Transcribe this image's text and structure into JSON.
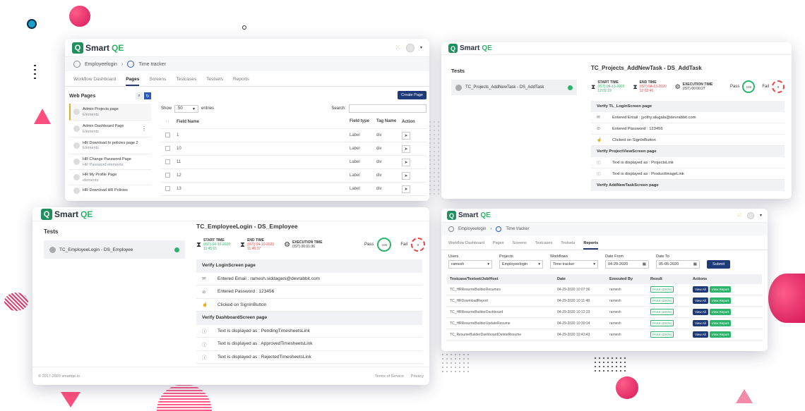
{
  "brand": {
    "logo_smart": "Smart",
    "logo_qe": "QE"
  },
  "colors": {
    "accent": "#1e3a78",
    "green": "#2db36a",
    "pink": "#e8336d",
    "red": "#e84545"
  },
  "win1": {
    "breadcrumb": [
      "Employeelogin",
      "Time tracker"
    ],
    "tabs": [
      "Workflow Dashboard",
      "Pages",
      "Screens",
      "Testcases",
      "Testsets",
      "Reports"
    ],
    "sidebar_title": "Web Pages",
    "pages": [
      {
        "title": "Admin Projects page",
        "sub": "Elements"
      },
      {
        "title": "Admin Dashboard Page",
        "sub": "Elements"
      },
      {
        "title": "HR Download hr policies page 2",
        "sub": "Elements"
      },
      {
        "title": "HR Change Password Page",
        "sub": "HR Password elements"
      },
      {
        "title": "HR My Profile Page",
        "sub": "elements"
      },
      {
        "title": "HR Download HR Policies",
        "sub": ""
      }
    ],
    "create_label": "Create Page",
    "show_label": "Show",
    "show_value": "50",
    "entries_label": "entries",
    "search_label": "Search:",
    "columns": [
      "Field Name",
      "Field type",
      "Tag Name",
      "Action"
    ],
    "rows": [
      {
        "name": "1",
        "type": "Label",
        "tag": "div"
      },
      {
        "name": "10",
        "type": "Label",
        "tag": "div"
      },
      {
        "name": "11",
        "type": "Label",
        "tag": "div"
      },
      {
        "name": "12",
        "type": "Label",
        "tag": "div"
      },
      {
        "name": "13",
        "type": "Label",
        "tag": "div"
      }
    ]
  },
  "win2": {
    "tests_label": "Tests",
    "test_item": "TC_Projects_AddNewTask - DS_AddTask",
    "title": "TC_Projects_AddNewTask - DS_AddTask",
    "start_label": "START TIME",
    "start_value": "(IST) 04-13-2020 12:02:19",
    "end_label": "END TIME",
    "end_value": "(IST) 04-13-2020 12:02:46",
    "exec_label": "EXECUTION TIME",
    "exec_value": "(IST) 00:00:27",
    "pass_label": "Pass",
    "pass_value": "100",
    "fail_label": "Fail",
    "fail_value": "0",
    "steps": [
      {
        "kind": "head",
        "text": "Verify TL_LoginScreen page"
      },
      {
        "kind": "step",
        "icon": "mail-icon",
        "glyph": "✉",
        "text": "Entered Email : jyothy.alugala@devrabbit.com"
      },
      {
        "kind": "step",
        "icon": "eye-off-icon",
        "glyph": "⊘",
        "text": "Entered Password : 123456"
      },
      {
        "kind": "step",
        "icon": "pointer-icon",
        "glyph": "☝",
        "text": "Clicked on SignInButton"
      },
      {
        "kind": "head",
        "text": "Verify ProjectViewScreen page"
      },
      {
        "kind": "step",
        "icon": "info-icon",
        "glyph": "ⓘ",
        "text": "Text is displayed as : ProjectsLink"
      },
      {
        "kind": "step",
        "icon": "info-icon",
        "glyph": "ⓘ",
        "text": "Text is displayed as : ProductImageLink"
      },
      {
        "kind": "head",
        "text": "Verify AddNewTaskScreen page"
      }
    ]
  },
  "win3": {
    "tests_label": "Tests",
    "test_item": "TC_EmployeeLogin - DS_Employee",
    "title": "TC_EmployeeLogin - DS_Employee",
    "start_label": "START TIME",
    "start_value": "(IST) 04-10-2020 11:45:01",
    "end_label": "END TIME",
    "end_value": "(IST) 04-10-2020 11:46:37",
    "exec_label": "EXECUTION TIME",
    "exec_value": "(IST) 00:01:36",
    "pass_label": "Pass",
    "pass_value": "100",
    "fail_label": "Fail",
    "fail_value": "0",
    "steps": [
      {
        "kind": "head",
        "text": "Verify LoginScreen page"
      },
      {
        "kind": "step",
        "icon": "mail-icon",
        "glyph": "✉",
        "text": "Entered Email : ramesh.siddagani@devrabbit.com"
      },
      {
        "kind": "step",
        "icon": "eye-off-icon",
        "glyph": "⊘",
        "text": "Entered Password : 123456"
      },
      {
        "kind": "step",
        "icon": "pointer-icon",
        "glyph": "☝",
        "text": "Clicked on SignInButton"
      },
      {
        "kind": "head",
        "text": "Verify DashboardScreen page"
      },
      {
        "kind": "step",
        "icon": "info-icon",
        "glyph": "ⓘ",
        "text": "Text is displayed as : PendingTimesheetsLink"
      },
      {
        "kind": "step",
        "icon": "info-icon",
        "glyph": "ⓘ",
        "text": "Text is displayed as : ApprovedTimesheetsLink"
      },
      {
        "kind": "step",
        "icon": "info-icon",
        "glyph": "ⓘ",
        "text": "Text is displayed as : RejectedTimesheetsLink"
      }
    ],
    "copyright": "© 2017-2020 smartqe.io",
    "terms": "Terms of Service",
    "privacy": "Privacy"
  },
  "win4": {
    "breadcrumb": [
      "Employeelogin",
      "Time tracker"
    ],
    "tabs": [
      "Workflow Dashboard",
      "Pages",
      "Screens",
      "Testcases",
      "Testsets",
      "Reports"
    ],
    "filters": [
      {
        "label": "Users",
        "value": "ramesh"
      },
      {
        "label": "Projects",
        "value": "Employeelogin"
      },
      {
        "label": "Workflows",
        "value": "Time tracker"
      },
      {
        "label": "Date From",
        "value": "04-29-2020"
      },
      {
        "label": "Date To",
        "value": "05-05-2020"
      }
    ],
    "submit_label": "Submit",
    "columns": [
      "Testcase/Testset/Job/Host",
      "Date",
      "Executed By",
      "Result",
      "Actions"
    ],
    "pass_label": "PASS (100%)",
    "view_all": "View All",
    "view_report": "View Report",
    "rows": [
      {
        "name": "TC_HRResumeBuilderResumes",
        "date": "04-29-2020 10:07:36",
        "by": "ramesh"
      },
      {
        "name": "TC_HRDownloadReport",
        "date": "04-29-2020 10:11:48",
        "by": "ramesh"
      },
      {
        "name": "TC_HRResumeBuilderDashboard",
        "date": "04-29-2020 10:12:23",
        "by": "ramesh"
      },
      {
        "name": "TC_HRResumeBuilderUpdateResume",
        "date": "04-29-2020 10:30:14",
        "by": "ramesh"
      },
      {
        "name": "TC_ResumeBuilderDashboardDeleteResume",
        "date": "04-29-2020 10:43:43",
        "by": "ramesh"
      }
    ]
  }
}
